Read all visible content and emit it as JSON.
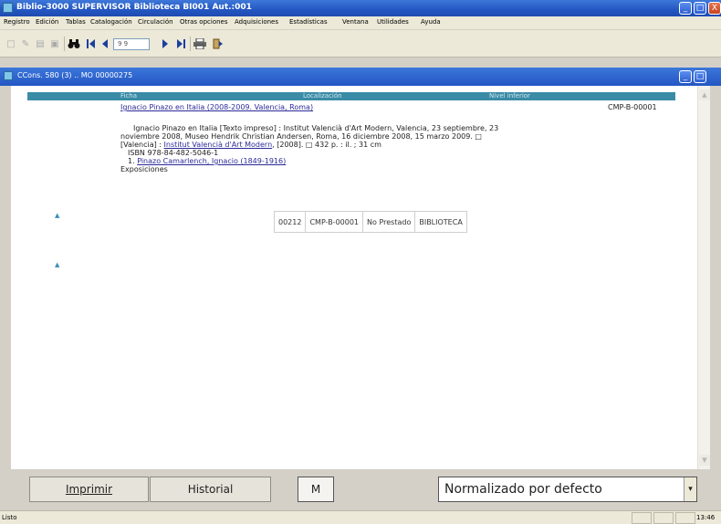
{
  "app": {
    "title": "Biblio-3000 SUPERVISOR  Biblioteca BI001 Aut.:001",
    "minimize": "_",
    "maximize": "□",
    "close": "X"
  },
  "menu": [
    "Registro",
    "Edición",
    "Tablas",
    "Catalogación",
    "Circulación",
    "Otras opciones",
    "Adquisiciones",
    "Estadísticas",
    "Ventana",
    "Utilidades",
    "Ayuda"
  ],
  "toolbar": {
    "record_field": "9 9",
    "icons": [
      "new-icon",
      "edit-icon",
      "delete-icon",
      "save-icon",
      "binoculars-icon",
      "first-record-icon",
      "previous-record-icon",
      "next-record-icon",
      "last-record-icon",
      "print-icon",
      "exit-icon"
    ]
  },
  "child_window": {
    "title": "CCons. 580 (3) .. MO 00000275",
    "minimize": "_",
    "maximize": "□"
  },
  "record_view": {
    "headers": [
      "Ficha",
      "Localización",
      "Nivel inferior"
    ],
    "title_link": "Ignacio Pinazo en Italia (2008-2009. Valencia, Roma)",
    "call_number": "CMP-B-00001",
    "description_line1": "Ignacio Pinazo en Italia [Texto impreso] : Institut Valencià d'Art Modern, Valencia, 23 septiembre, 23",
    "description_line2": "noviembre 2008, Museo Hendrik Christian Andersen, Roma, 16 diciembre 2008, 15 marzo 2009. □",
    "publisher_prefix": "[Valencia] :",
    "publisher_link": "Institut Valencià d'Art Modern",
    "publisher_suffix": ", [2008]. □  432 p. : il. ; 31 cm",
    "isbn": "ISBN 978-84-482-5046-1",
    "subject_number": "1.",
    "subject_link": "Pinazo Camarlench, Ignacio (1849-1916)",
    "subject_category": "Exposiciones",
    "marker": "▲",
    "holdings": [
      "00212",
      "CMP-B-00001",
      "No Prestado",
      "BIBLIOTECA"
    ]
  },
  "buttons": {
    "print": "Imprimir",
    "history": "Historial",
    "m": "M"
  },
  "format_select": {
    "value": "Normalizado por defecto",
    "arrow": "▾"
  },
  "status": {
    "text": "Listo",
    "clock": "13:46"
  }
}
